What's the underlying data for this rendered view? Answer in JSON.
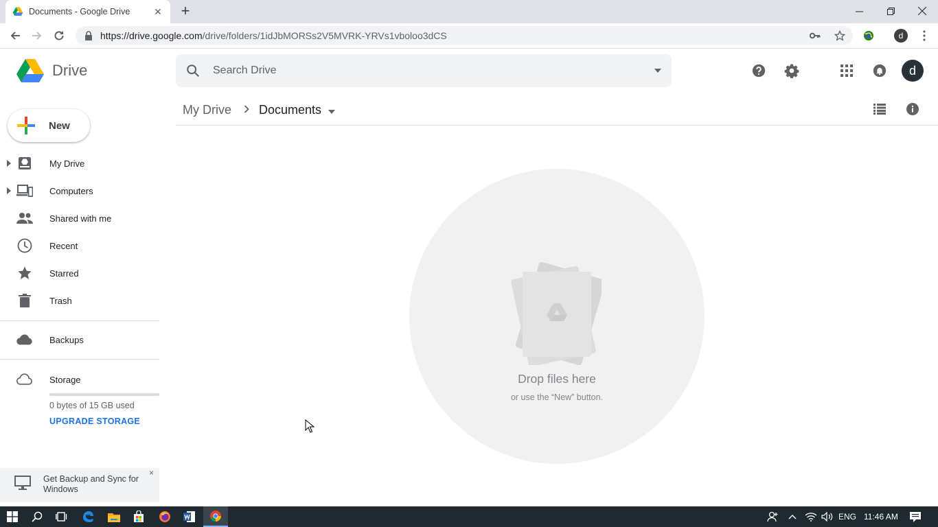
{
  "browser": {
    "tab_title": "Documents - Google Drive",
    "url_host": "https://drive.google.com",
    "url_path": "/drive/folders/1idJbMORSs2V5MVRK-YRVs1vboloo3dCS",
    "profile_initial": "d"
  },
  "drive": {
    "logo_text": "Drive",
    "search_placeholder": "Search Drive",
    "avatar_initial": "d",
    "breadcrumb": {
      "root": "My Drive",
      "current": "Documents"
    },
    "new_button_label": "New",
    "nav_items": [
      {
        "label": "My Drive",
        "icon": "my-drive-icon"
      },
      {
        "label": "Computers",
        "icon": "computers-icon"
      },
      {
        "label": "Shared with me",
        "icon": "shared-icon"
      },
      {
        "label": "Recent",
        "icon": "clock-icon"
      },
      {
        "label": "Starred",
        "icon": "star-icon"
      },
      {
        "label": "Trash",
        "icon": "trash-icon"
      },
      {
        "label": "Backups",
        "icon": "cloud-icon"
      },
      {
        "label": "Storage",
        "icon": "cloud-outline-icon"
      }
    ],
    "storage": {
      "used_text": "0 bytes of 15 GB used",
      "used_fraction": 0,
      "upgrade_label": "UPGRADE STORAGE"
    },
    "promo": {
      "text": "Get Backup and Sync for Windows",
      "close": "×"
    },
    "empty_state": {
      "title": "Drop files here",
      "subtitle": "or use the “New” button."
    }
  },
  "taskbar": {
    "language": "ENG",
    "time": "11:46 AM"
  },
  "colors": {
    "accent": "#1a73e8",
    "taskbar": "#1e2a30"
  }
}
